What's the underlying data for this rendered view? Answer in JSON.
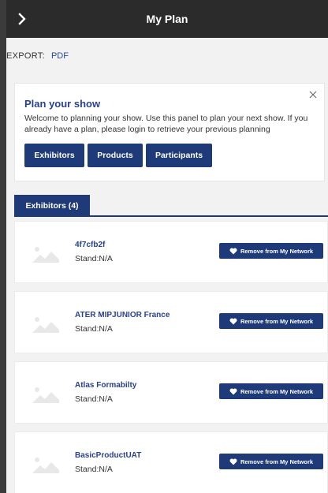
{
  "header": {
    "title": "My Plan",
    "back_icon": "chevron-right-icon"
  },
  "export": {
    "label": "EXPORT:",
    "pdf_label": "PDF"
  },
  "plan": {
    "title": "Plan your show",
    "description": "Welcome to planning your show. Use this panel to plan your next show. If you already have a plan, please login to retrieve your previous planning",
    "buttons": [
      "Exhibitors",
      "Products",
      "Participants"
    ]
  },
  "tabs": {
    "active_label": "Exhibitors (4)"
  },
  "exhibitors": [
    {
      "name": "4f7cfb2f",
      "stand": "Stand:N/A",
      "action": "Remove from My Network"
    },
    {
      "name": "ATER MIPJUNIOR France",
      "stand": "Stand:N/A",
      "action": "Remove from My Network"
    },
    {
      "name": "Atlas Formabilty",
      "stand": "Stand:N/A",
      "action": "Remove from My Network"
    },
    {
      "name": "BasicProductUAT",
      "stand": "Stand:N/A",
      "action": "Remove from My Network"
    }
  ],
  "colors": {
    "accent": "#1e3a78",
    "link": "#2a4190",
    "topbar": "#2b2b2b"
  }
}
